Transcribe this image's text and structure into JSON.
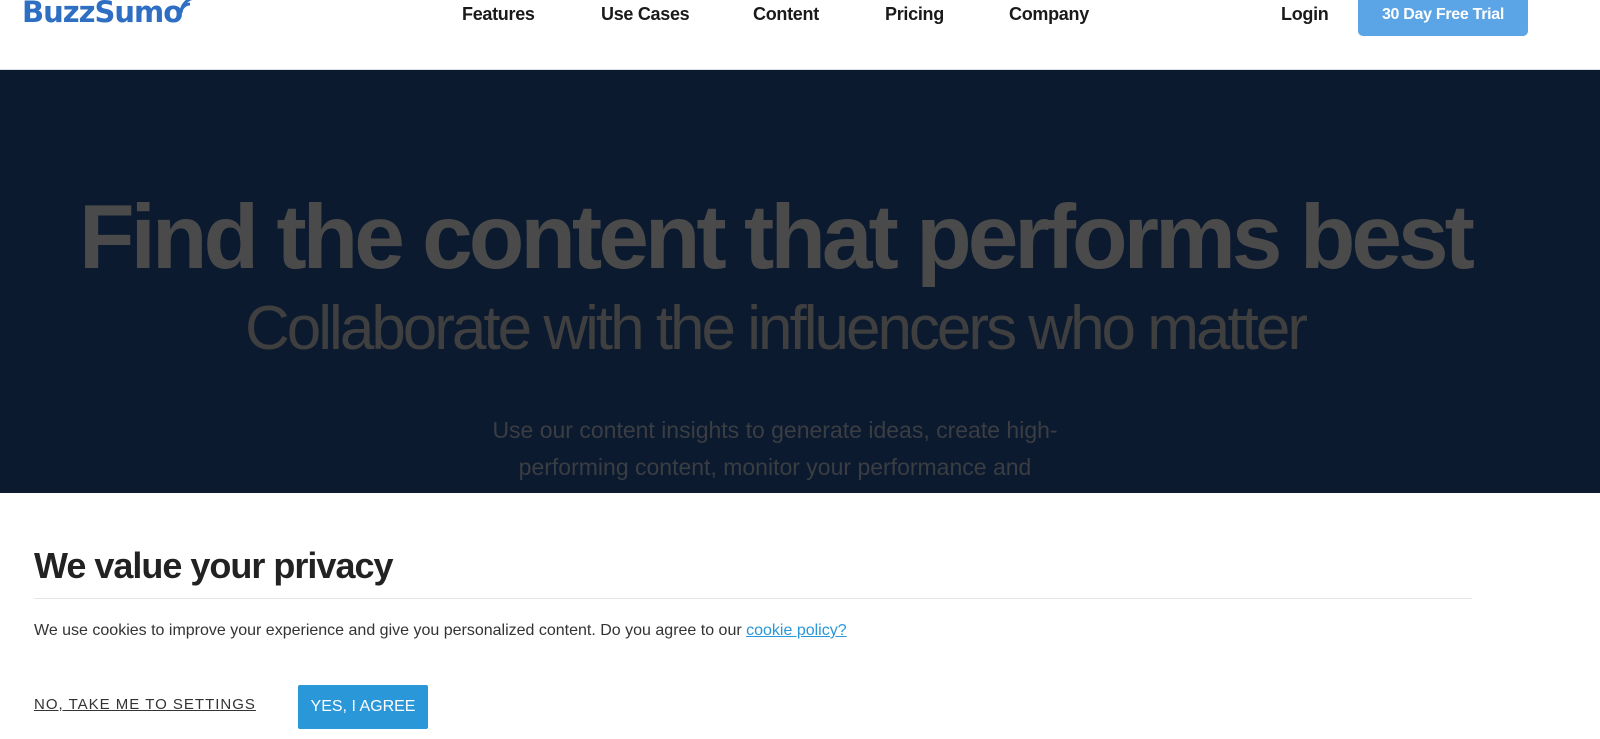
{
  "header": {
    "logo_text": "BuzzSumo",
    "nav": [
      "Features",
      "Use Cases",
      "Content",
      "Pricing",
      "Company"
    ],
    "login_label": "Login",
    "trial_button_label": "30 Day Free Trial"
  },
  "hero": {
    "title": "Find the content that performs best",
    "subtitle": "Collaborate with the influencers who matter",
    "description": "Use our content insights to generate ideas, create high-performing content, monitor your performance and"
  },
  "cookie_banner": {
    "title": "We value your privacy",
    "text": "We use cookies to improve your experience and give you personalized content. Do you agree to our ",
    "link_text": "cookie policy?",
    "decline_label": "NO, TAKE ME TO SETTINGS",
    "accept_label": "YES, I AGREE"
  },
  "colors": {
    "brand": "#2f6fc3",
    "trial_button": "#5ba4e6",
    "hero_background": "#0c1a30",
    "accept_button": "#2a97d9",
    "link": "#2a97d9"
  }
}
